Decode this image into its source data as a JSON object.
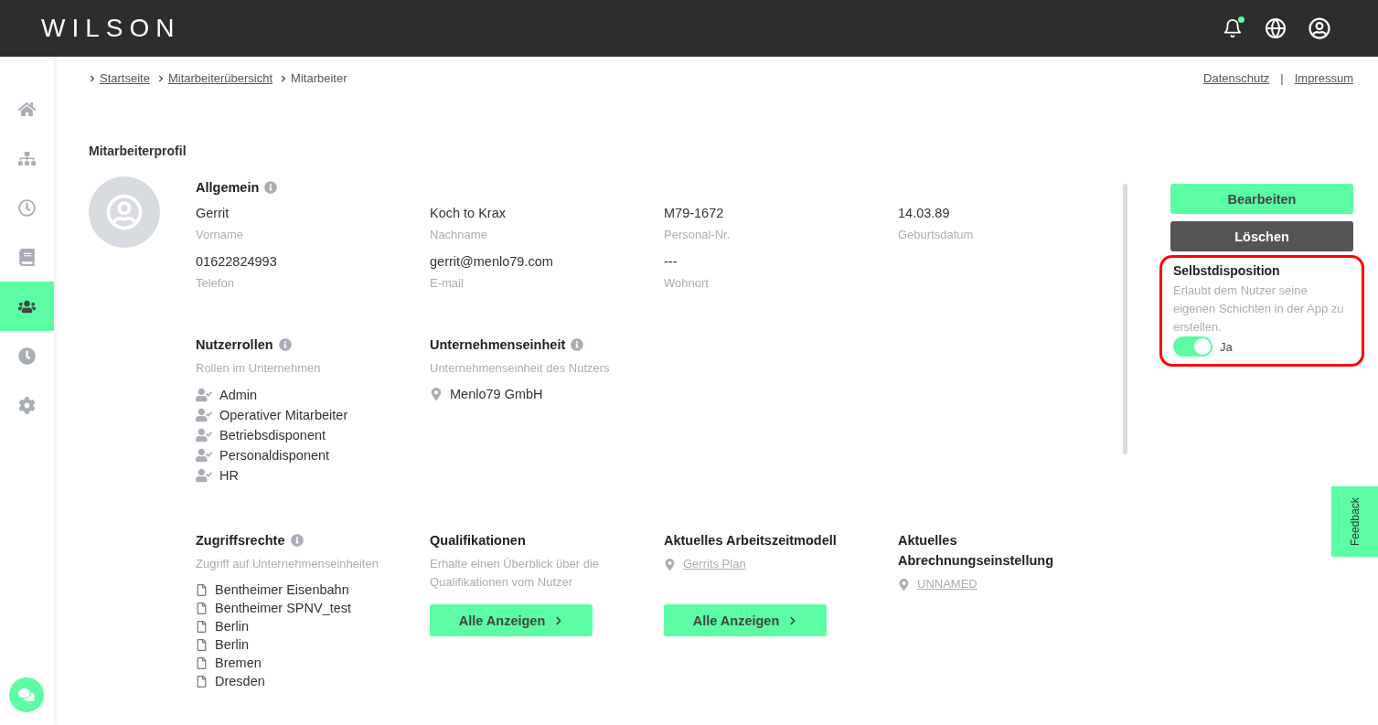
{
  "header": {
    "logo": "WILSON",
    "notification_unread": true
  },
  "sidebar": {
    "items": [
      {
        "kind": "home",
        "selected": false
      },
      {
        "kind": "structure",
        "selected": false
      },
      {
        "kind": "time",
        "selected": false
      },
      {
        "kind": "book",
        "selected": false
      },
      {
        "kind": "users",
        "selected": true
      },
      {
        "kind": "clock",
        "selected": false
      },
      {
        "kind": "settings",
        "selected": false
      }
    ]
  },
  "breadcrumb": [
    {
      "label": "Startseite",
      "link": true
    },
    {
      "label": "Mitarbeiterübersicht",
      "link": true
    },
    {
      "label": "Mitarbeiter",
      "link": false
    }
  ],
  "footer_links": [
    "Datenschutz",
    "Impressum"
  ],
  "footer_separator": "|",
  "page_title": "Mitarbeiterprofil",
  "general": {
    "title": "Allgemein",
    "fields": [
      {
        "value": "Gerrit",
        "label": "Vorname"
      },
      {
        "value": "Koch to Krax",
        "label": "Nachname"
      },
      {
        "value": "M79-1672",
        "label": "Personal-Nr."
      },
      {
        "value": "14.03.89",
        "label": "Geburtsdatum"
      },
      {
        "value": "01622824993",
        "label": "Telefon"
      },
      {
        "value": "gerrit@menlo79.com",
        "label": "E-mail"
      },
      {
        "value": "---",
        "label": "Wohnort"
      }
    ]
  },
  "roles": {
    "title": "Nutzerrollen",
    "subtitle": "Rollen im Unternehmen",
    "items": [
      "Admin",
      "Operativer Mitarbeiter",
      "Betriebsdisponent",
      "Personaldisponent",
      "HR"
    ]
  },
  "unit": {
    "title": "Unternehmenseinheit",
    "subtitle": "Unternehmenseinheit des Nutzers",
    "value": "Menlo79 GmbH"
  },
  "access": {
    "title": "Zugriffsrechte",
    "subtitle": "Zugriff auf Unternehmenseinheiten",
    "items": [
      "Bentheimer Eisenbahn",
      "Bentheimer SPNV_test",
      "Berlin",
      "Berlin",
      "Bremen",
      "Dresden"
    ]
  },
  "qualifications": {
    "title": "Qualifikationen",
    "subtitle": "Erhalte einen Überblick über die Qualifikationen vom Nutzer",
    "button": "Alle Anzeigen"
  },
  "working_time": {
    "title": "Aktuelles Arbeitszeitmodell",
    "link": "Gerrits Plan",
    "button": "Alle Anzeigen"
  },
  "billing": {
    "title_lines": [
      "Aktuelles",
      "Abrechnungseinstellung"
    ],
    "link": "UNNAMED"
  },
  "actions": [
    {
      "label": "Bearbeiten",
      "kind": "primary"
    },
    {
      "label": "Löschen",
      "kind": "danger"
    }
  ],
  "self_disposition": {
    "title": "Selbstdisposition",
    "description": "Erlaubt dem Nutzer seine eigenen Schichten in der App zu erstellen.",
    "on": true,
    "state_label": "Ja",
    "highlighted": true
  },
  "feedback": "Feedback"
}
